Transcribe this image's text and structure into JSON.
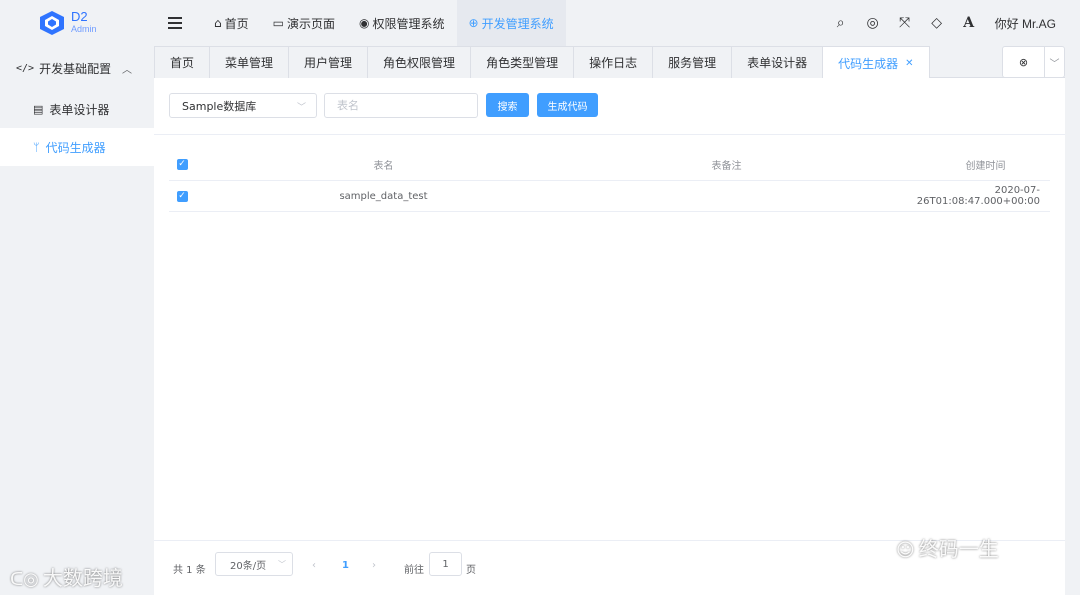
{
  "app": {
    "logo_main": "D2",
    "logo_sub": "Admin",
    "accent_color": "#409eff",
    "brand_color": "#2f74ff"
  },
  "header": {
    "nav": [
      {
        "label": "首页",
        "icon": "home-icon"
      },
      {
        "label": "演示页面",
        "icon": "folder-icon"
      },
      {
        "label": "权限管理系统",
        "icon": "chrome-icon"
      },
      {
        "label": "开发管理系统",
        "icon": "globe-icon",
        "active": true
      }
    ],
    "right_icons": [
      "search-icon",
      "target-icon",
      "fullscreen-icon",
      "diamond-icon",
      "font-icon"
    ],
    "user_greeting": "你好 Mr.AG"
  },
  "sidebar": {
    "group_label": "开发基础配置",
    "items": [
      {
        "label": "表单设计器",
        "icon": "form-icon"
      },
      {
        "label": "代码生成器",
        "icon": "branch-icon",
        "active": true
      }
    ]
  },
  "tabs": [
    {
      "label": "首页"
    },
    {
      "label": "菜单管理"
    },
    {
      "label": "用户管理"
    },
    {
      "label": "角色权限管理"
    },
    {
      "label": "角色类型管理"
    },
    {
      "label": "操作日志"
    },
    {
      "label": "服务管理"
    },
    {
      "label": "表单设计器"
    },
    {
      "label": "代码生成器",
      "active": true
    }
  ],
  "toolbar": {
    "database_select": "Sample数据库",
    "table_name_placeholder": "表名",
    "search_label": "搜索",
    "generate_label": "生成代码"
  },
  "table": {
    "headers": {
      "name": "表名",
      "remark": "表备注",
      "created": "创建时间"
    },
    "rows": [
      {
        "checked": true,
        "name": "sample_data_test",
        "remark": "",
        "created": "2020-07-26T01:08:47.000+00:00"
      }
    ]
  },
  "pagination": {
    "total_text": "共 1 条",
    "page_size": "20条/页",
    "current_page": "1",
    "goto_label": "前往",
    "goto_value": "1",
    "page_suffix": "页"
  },
  "watermarks": {
    "left": "大数跨境",
    "right": "终码一生"
  }
}
